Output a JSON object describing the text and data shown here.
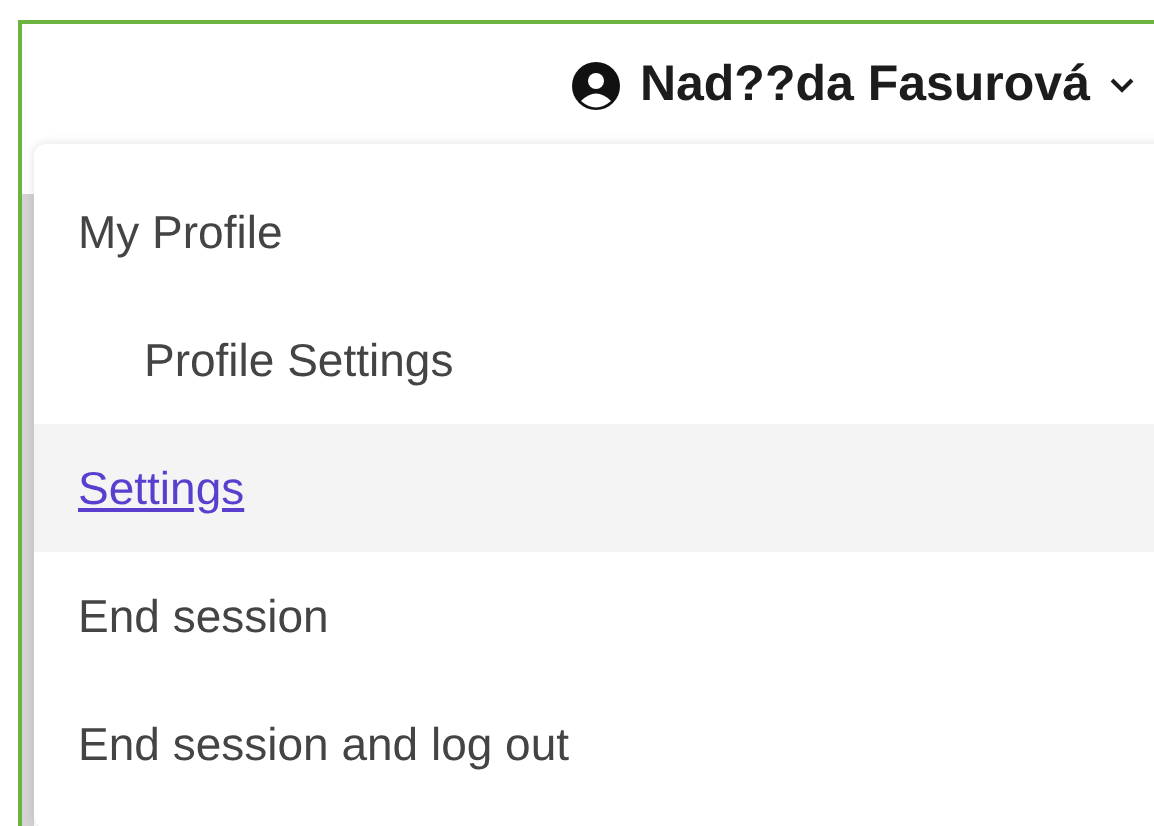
{
  "user_menu": {
    "name": "Nad??da Fasurová",
    "expanded": true
  },
  "menu_items": [
    {
      "label": "My Profile",
      "selected": false,
      "children": [
        {
          "label": "Profile Settings",
          "selected": false
        }
      ]
    },
    {
      "label": "Settings",
      "selected": true
    },
    {
      "label": "End session",
      "selected": false
    },
    {
      "label": "End session and log out",
      "selected": false
    }
  ]
}
